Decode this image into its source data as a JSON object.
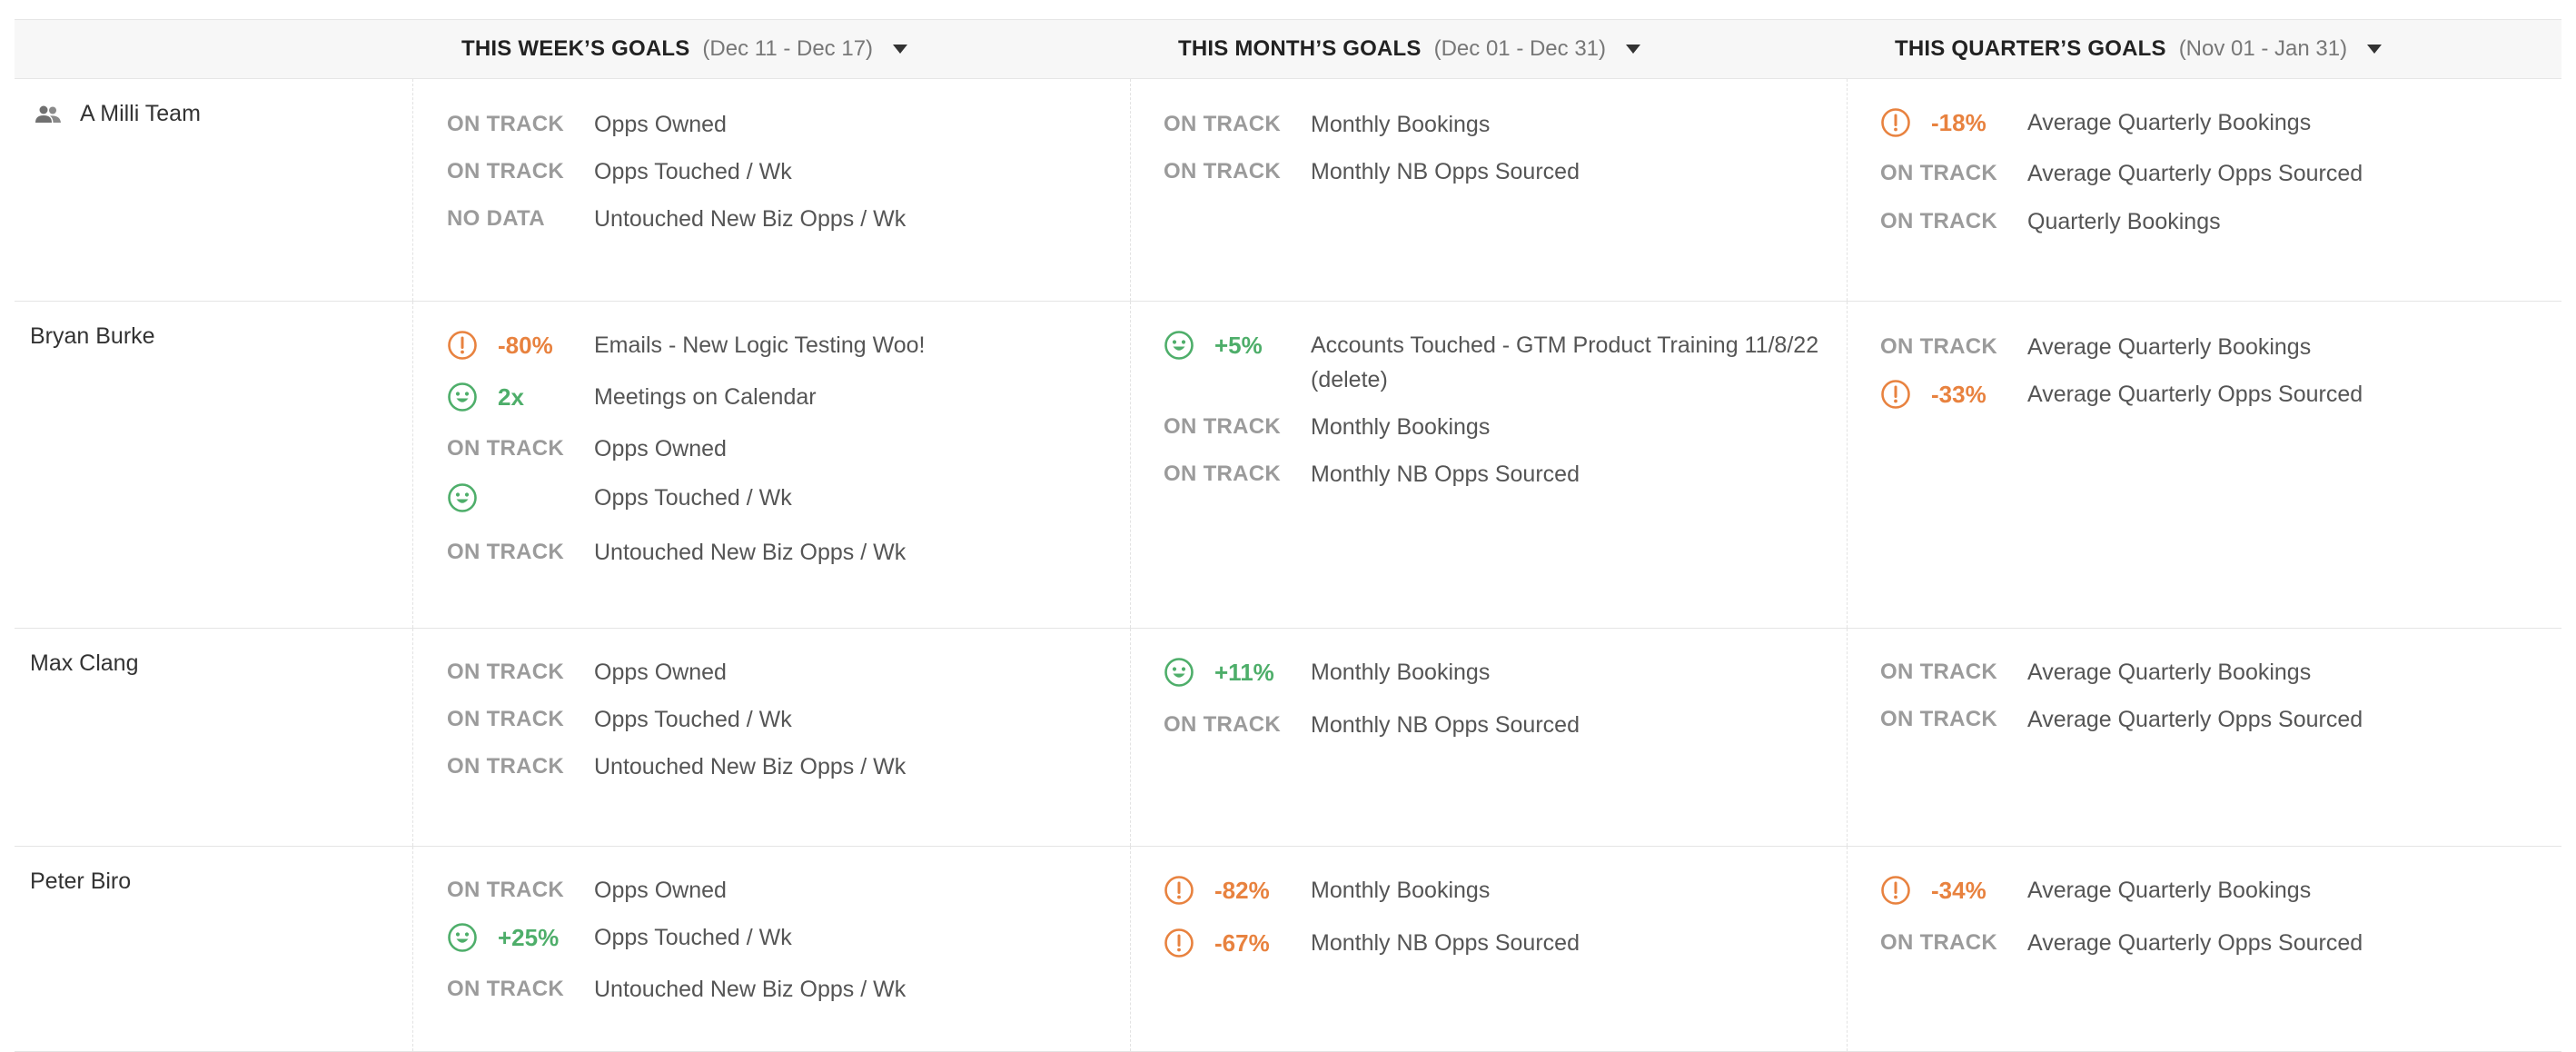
{
  "header": {
    "columns": [
      {
        "title": "THIS WEEK’S GOALS",
        "range": "(Dec 11 - Dec 17)"
      },
      {
        "title": "THIS MONTH’S GOALS",
        "range": "(Dec 01 - Dec 31)"
      },
      {
        "title": "THIS QUARTER’S GOALS",
        "range": "(Nov 01 - Jan 31)"
      }
    ]
  },
  "colors": {
    "warning": "#e8823f",
    "success": "#4eae6a",
    "status_gray": "#9b9b9b"
  },
  "rows": [
    {
      "name": "A Milli Team",
      "icon": "team-icon",
      "week": [
        {
          "status": "ON TRACK",
          "goal": "Opps Owned"
        },
        {
          "status": "ON TRACK",
          "goal": "Opps Touched / Wk"
        },
        {
          "status": "NO DATA",
          "goal": "Untouched New Biz Opps / Wk"
        }
      ],
      "month": [
        {
          "status": "ON TRACK",
          "goal": "Monthly Bookings"
        },
        {
          "status": "ON TRACK",
          "goal": "Monthly NB Opps Sourced"
        }
      ],
      "quarter": [
        {
          "icon": "warning-icon",
          "pct": "-18%",
          "goal": "Average Quarterly Bookings"
        },
        {
          "status": "ON TRACK",
          "goal": "Average Quarterly Opps Sourced"
        },
        {
          "status": "ON TRACK",
          "goal": "Quarterly Bookings"
        }
      ]
    },
    {
      "name": "Bryan Burke",
      "week": [
        {
          "icon": "warning-icon",
          "pct": "-80%",
          "goal": "Emails - New Logic Testing Woo!"
        },
        {
          "icon": "smiley-icon",
          "pct": "2x",
          "goal": "Meetings on Calendar"
        },
        {
          "status": "ON TRACK",
          "goal": "Opps Owned"
        },
        {
          "icon": "smiley-icon",
          "pct": "",
          "goal": "Opps Touched / Wk"
        },
        {
          "status": "ON TRACK",
          "goal": "Untouched New Biz Opps / Wk"
        }
      ],
      "month": [
        {
          "icon": "smiley-icon",
          "pct": "+5%",
          "goal": "Accounts Touched - GTM Product Training 11/8/22 (delete)"
        },
        {
          "status": "ON TRACK",
          "goal": "Monthly Bookings"
        },
        {
          "status": "ON TRACK",
          "goal": "Monthly NB Opps Sourced"
        }
      ],
      "quarter": [
        {
          "status": "ON TRACK",
          "goal": "Average Quarterly Bookings"
        },
        {
          "icon": "warning-icon",
          "pct": "-33%",
          "goal": "Average Quarterly Opps Sourced"
        }
      ]
    },
    {
      "name": "Max Clang",
      "week": [
        {
          "status": "ON TRACK",
          "goal": "Opps Owned"
        },
        {
          "status": "ON TRACK",
          "goal": "Opps Touched / Wk"
        },
        {
          "status": "ON TRACK",
          "goal": "Untouched New Biz Opps / Wk"
        }
      ],
      "month": [
        {
          "icon": "smiley-icon",
          "pct": "+11%",
          "goal": "Monthly Bookings"
        },
        {
          "status": "ON TRACK",
          "goal": "Monthly NB Opps Sourced"
        }
      ],
      "quarter": [
        {
          "status": "ON TRACK",
          "goal": "Average Quarterly Bookings"
        },
        {
          "status": "ON TRACK",
          "goal": "Average Quarterly Opps Sourced"
        }
      ]
    },
    {
      "name": "Peter Biro",
      "week": [
        {
          "status": "ON TRACK",
          "goal": "Opps Owned"
        },
        {
          "icon": "smiley-icon",
          "pct": "+25%",
          "goal": "Opps Touched / Wk"
        },
        {
          "status": "ON TRACK",
          "goal": "Untouched New Biz Opps / Wk"
        }
      ],
      "month": [
        {
          "icon": "warning-icon",
          "pct": "-82%",
          "goal": "Monthly Bookings"
        },
        {
          "icon": "warning-icon",
          "pct": "-67%",
          "goal": "Monthly NB Opps Sourced"
        }
      ],
      "quarter": [
        {
          "icon": "warning-icon",
          "pct": "-34%",
          "goal": "Average Quarterly Bookings"
        },
        {
          "status": "ON TRACK",
          "goal": "Average Quarterly Opps Sourced"
        }
      ]
    }
  ]
}
